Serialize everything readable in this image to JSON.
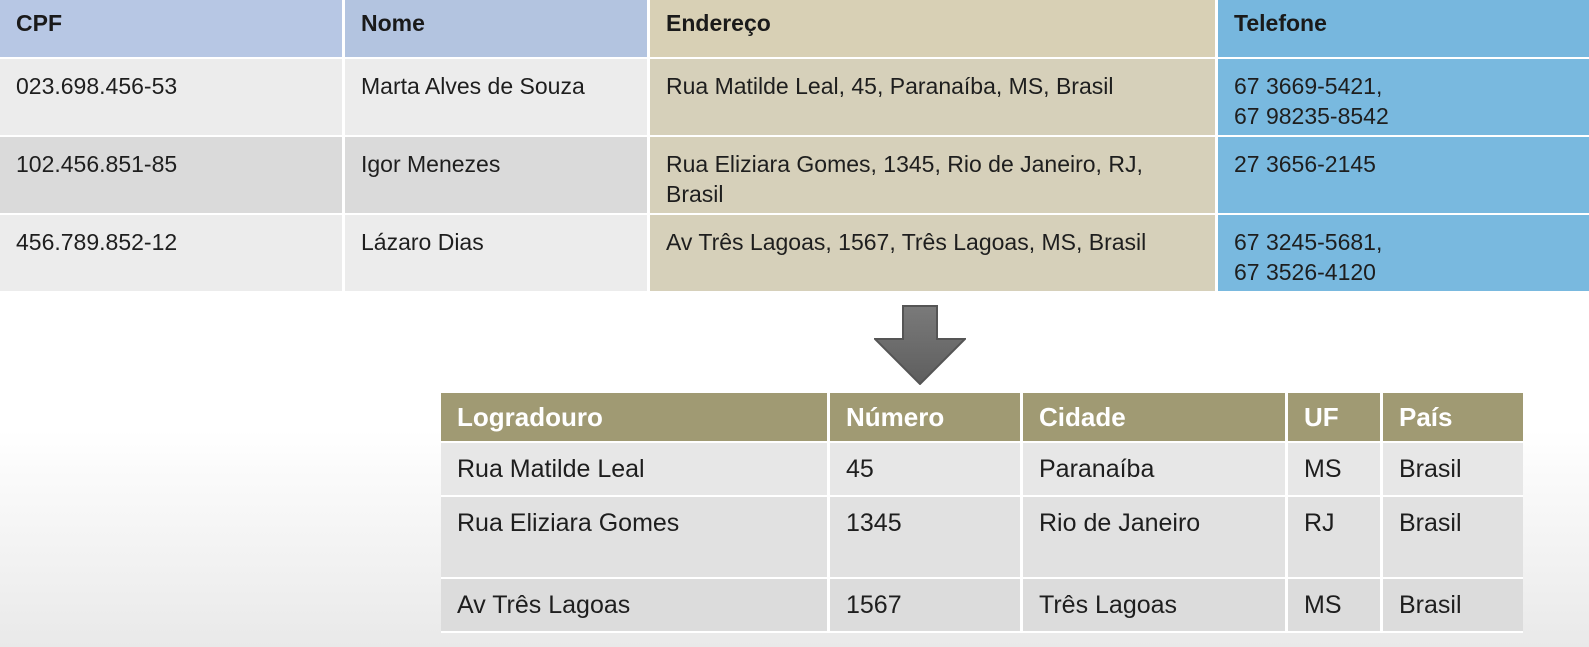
{
  "top_table": {
    "headers": [
      "CPF",
      "Nome",
      "Endereço",
      "Telefone"
    ],
    "rows": [
      {
        "cpf": "023.698.456-53",
        "nome": "Marta Alves de Souza",
        "endereco": "Rua Matilde Leal, 45, Paranaíba, MS, Brasil",
        "telefone": [
          "67 3669-5421,",
          "67 98235-8542"
        ]
      },
      {
        "cpf": "102.456.851-85",
        "nome": "Igor Menezes",
        "endereco": "Rua Eliziara Gomes, 1345, Rio de Janeiro, RJ, Brasil",
        "telefone": [
          "27 3656-2145"
        ]
      },
      {
        "cpf": "456.789.852-12",
        "nome": "Lázaro Dias",
        "endereco": "Av Três Lagoas, 1567, Três Lagoas, MS, Brasil",
        "telefone": [
          "67 3245-5681,",
          "67 3526-4120"
        ]
      }
    ]
  },
  "bottom_table": {
    "headers": [
      "Logradouro",
      "Número",
      "Cidade",
      "UF",
      "País"
    ],
    "rows": [
      {
        "logradouro": "Rua Matilde Leal",
        "numero": "45",
        "cidade": "Paranaíba",
        "uf": "MS",
        "pais": "Brasil"
      },
      {
        "logradouro": "Rua Eliziara Gomes",
        "numero": "1345",
        "cidade": "Rio de Janeiro",
        "uf": "RJ",
        "pais": "Brasil"
      },
      {
        "logradouro": "Av Três Lagoas",
        "numero": "1567",
        "cidade": "Três Lagoas",
        "uf": "MS",
        "pais": "Brasil"
      }
    ]
  },
  "arrow": {
    "icon": "down-arrow-icon",
    "color": "#6f6f6f"
  }
}
